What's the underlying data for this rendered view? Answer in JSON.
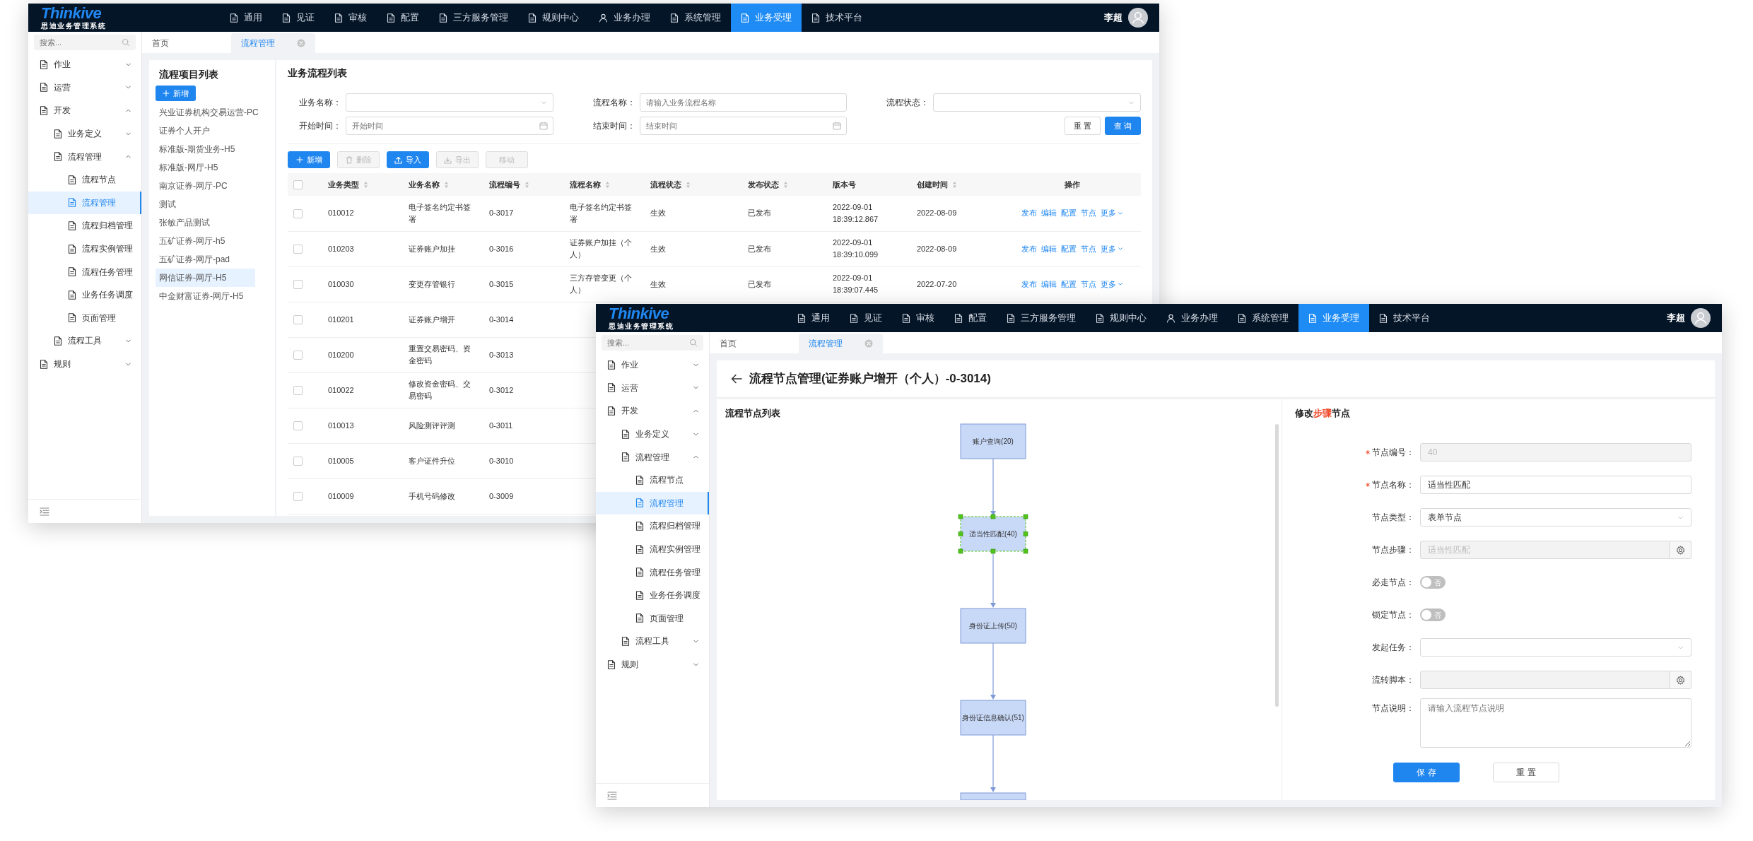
{
  "list_window": {
    "logo": {
      "name": "Thinkive",
      "subtitle": "思迪业务管理系统"
    },
    "nav": [
      {
        "label": "通用",
        "selected": false
      },
      {
        "label": "见证",
        "selected": false
      },
      {
        "label": "审核",
        "selected": false
      },
      {
        "label": "配置",
        "selected": false
      },
      {
        "label": "三方服务管理",
        "selected": false
      },
      {
        "label": "规则中心",
        "selected": false
      },
      {
        "label": "业务办理",
        "selected": false
      },
      {
        "label": "系统管理",
        "selected": false
      },
      {
        "label": "业务受理",
        "selected": true
      },
      {
        "label": "技术平台",
        "selected": false
      }
    ],
    "user": "李超",
    "sidebar": {
      "search_placeholder": "搜索...",
      "items": [
        {
          "label": "作业",
          "expanded": false
        },
        {
          "label": "运营",
          "expanded": false
        },
        {
          "label": "开发",
          "expanded": true,
          "children": [
            {
              "label": "业务定义",
              "expanded": false
            },
            {
              "label": "流程管理",
              "expanded": true,
              "children": [
                {
                  "label": "流程节点",
                  "selected": false
                },
                {
                  "label": "流程管理",
                  "selected": true
                },
                {
                  "label": "流程归档管理",
                  "selected": false
                },
                {
                  "label": "流程实例管理",
                  "selected": false
                },
                {
                  "label": "流程任务管理",
                  "selected": false
                },
                {
                  "label": "业务任务调度",
                  "selected": false
                },
                {
                  "label": "页面管理",
                  "selected": false
                }
              ]
            },
            {
              "label": "流程工具",
              "expanded": false
            }
          ]
        },
        {
          "label": "规则",
          "expanded": false
        }
      ]
    },
    "tabs": [
      {
        "label": "首页",
        "selected": false,
        "closable": false
      },
      {
        "label": "流程管理",
        "selected": true,
        "closable": true
      }
    ],
    "project_panel": {
      "title": "流程项目列表",
      "add_button": "新增",
      "projects": [
        {
          "label": "兴业证券机构交易运营-PC",
          "selected": false
        },
        {
          "label": "证券个人开户",
          "selected": false
        },
        {
          "label": "标准版-期货业务-H5",
          "selected": false
        },
        {
          "label": "标准版-网厅-H5",
          "selected": false
        },
        {
          "label": "南京证券-网厅-PC",
          "selected": false
        },
        {
          "label": "测试",
          "selected": false
        },
        {
          "label": "张敏产品测试",
          "selected": false
        },
        {
          "label": "五矿证券-网厅-h5",
          "selected": false
        },
        {
          "label": "五矿证券-网厅-pad",
          "selected": false
        },
        {
          "label": "网信证券-网厅-H5",
          "selected": true
        },
        {
          "label": "中金财富证券-网厅-H5",
          "selected": false
        }
      ]
    },
    "flow_list": {
      "title": "业务流程列表",
      "filters": [
        {
          "label": "业务名称：",
          "kind": "select"
        },
        {
          "label": "流程名称：",
          "kind": "text",
          "placeholder": "请输入业务流程名称"
        },
        {
          "label": "流程状态：",
          "kind": "select"
        },
        {
          "label": "开始时间：",
          "kind": "date",
          "placeholder": "开始时间"
        },
        {
          "label": "结束时间：",
          "kind": "date",
          "placeholder": "结束时间"
        }
      ],
      "filter_buttons": [
        {
          "label": "重 置",
          "kind": "default"
        },
        {
          "label": "查 询",
          "kind": "primary"
        }
      ],
      "toolbar": [
        {
          "label": "新增",
          "kind": "primary",
          "disabled": false
        },
        {
          "label": "删除",
          "kind": "default",
          "disabled": true
        },
        {
          "label": "导入",
          "kind": "primary",
          "disabled": false
        },
        {
          "label": "导出",
          "kind": "default",
          "disabled": true
        },
        {
          "label": "移动",
          "kind": "default",
          "disabled": true
        }
      ],
      "table": {
        "all_checked": false,
        "columns": [
          {
            "label": "业务类型",
            "sortable": true
          },
          {
            "label": "业务名称",
            "sortable": true
          },
          {
            "label": "流程编号",
            "sortable": true
          },
          {
            "label": "流程名称",
            "sortable": true
          },
          {
            "label": "流程状态",
            "sortable": true
          },
          {
            "label": "发布状态",
            "sortable": true
          },
          {
            "label": "版本号",
            "sortable": false
          },
          {
            "label": "创建时间",
            "sortable": true
          },
          {
            "label": "操作",
            "sortable": false
          }
        ],
        "rows": [
          {
            "checked": false,
            "cells": [
              "010012",
              "电子签名约定书签署",
              "0-3017",
              "电子签名约定书签署",
              "生效",
              "已发布",
              "2022-09-01 18:39:12.867",
              "2022-08-09"
            ],
            "actions": [
              {
                "label": "发布",
                "dropdown": false
              },
              {
                "label": "编辑",
                "dropdown": false
              },
              {
                "label": "配置",
                "dropdown": false
              },
              {
                "label": "节点",
                "dropdown": false
              },
              {
                "label": "更多",
                "dropdown": true
              }
            ]
          },
          {
            "checked": false,
            "cells": [
              "010203",
              "证券账户加挂",
              "0-3016",
              "证券账户加挂（个人）",
              "生效",
              "已发布",
              "2022-09-01 18:39:10.099",
              "2022-08-09"
            ],
            "actions": [
              {
                "label": "发布",
                "dropdown": false
              },
              {
                "label": "编辑",
                "dropdown": false
              },
              {
                "label": "配置",
                "dropdown": false
              },
              {
                "label": "节点",
                "dropdown": false
              },
              {
                "label": "更多",
                "dropdown": true
              }
            ]
          },
          {
            "checked": false,
            "cells": [
              "010030",
              "变更存管银行",
              "0-3015",
              "三方存管变更（个人）",
              "生效",
              "已发布",
              "2022-09-01 18:39:07.445",
              "2022-07-20"
            ],
            "actions": [
              {
                "label": "发布",
                "dropdown": false
              },
              {
                "label": "编辑",
                "dropdown": false
              },
              {
                "label": "配置",
                "dropdown": false
              },
              {
                "label": "节点",
                "dropdown": false
              },
              {
                "label": "更多",
                "dropdown": true
              }
            ]
          },
          {
            "checked": false,
            "cells": [
              "010201",
              "证券账户增开",
              "0-3014"
            ]
          },
          {
            "checked": false,
            "cells": [
              "010200",
              "重置交易密码、资金密码",
              "0-3013"
            ]
          },
          {
            "checked": false,
            "cells": [
              "010022",
              "修改资金密码、交易密码",
              "0-3012"
            ]
          },
          {
            "checked": false,
            "cells": [
              "010013",
              "风险测评评测",
              "0-3011"
            ]
          },
          {
            "checked": false,
            "cells": [
              "010005",
              "客户证件升位",
              "0-3010"
            ]
          },
          {
            "checked": false,
            "cells": [
              "010009",
              "手机号码修改",
              "0-3009"
            ]
          }
        ]
      }
    }
  },
  "node_window": {
    "logo": {
      "name": "Thinkive",
      "subtitle": "思迪业务管理系统"
    },
    "nav": [
      {
        "label": "通用",
        "selected": false
      },
      {
        "label": "见证",
        "selected": false
      },
      {
        "label": "审核",
        "selected": false
      },
      {
        "label": "配置",
        "selected": false
      },
      {
        "label": "三方服务管理",
        "selected": false
      },
      {
        "label": "规则中心",
        "selected": false
      },
      {
        "label": "业务办理",
        "selected": false
      },
      {
        "label": "系统管理",
        "selected": false
      },
      {
        "label": "业务受理",
        "selected": true
      },
      {
        "label": "技术平台",
        "selected": false
      }
    ],
    "user": "李超",
    "sidebar": {
      "search_placeholder": "搜索...",
      "items": [
        {
          "label": "作业",
          "expanded": false
        },
        {
          "label": "运营",
          "expanded": false
        },
        {
          "label": "开发",
          "expanded": true,
          "children": [
            {
              "label": "业务定义",
              "expanded": false
            },
            {
              "label": "流程管理",
              "expanded": true,
              "children": [
                {
                  "label": "流程节点",
                  "selected": false
                },
                {
                  "label": "流程管理",
                  "selected": true
                },
                {
                  "label": "流程归档管理",
                  "selected": false
                },
                {
                  "label": "流程实例管理",
                  "selected": false
                },
                {
                  "label": "流程任务管理",
                  "selected": false
                },
                {
                  "label": "业务任务调度",
                  "selected": false
                },
                {
                  "label": "页面管理",
                  "selected": false
                }
              ]
            },
            {
              "label": "流程工具",
              "expanded": false
            }
          ]
        },
        {
          "label": "规则",
          "expanded": false
        }
      ]
    },
    "tabs": [
      {
        "label": "首页",
        "selected": false,
        "closable": false
      },
      {
        "label": "流程管理",
        "selected": true,
        "closable": true
      }
    ],
    "node_editor": {
      "title": "流程节点管理(证券账户增开（个人）-0-3014)",
      "diagram": {
        "title": "流程节点列表",
        "nodes": [
          {
            "label": "账户查询(20)",
            "selected": false
          },
          {
            "label": "适当性匹配(40)",
            "selected": true
          },
          {
            "label": "身份证上传(50)",
            "selected": false
          },
          {
            "label": "身份证信息确认(51)",
            "selected": false
          },
          {
            "selected": false
          }
        ]
      },
      "form": {
        "title": "修改**步骤**节点",
        "fields": [
          {
            "label": "节点编号：",
            "kind": "input",
            "required": true,
            "disabled": true,
            "value": "40"
          },
          {
            "label": "节点名称：",
            "kind": "input",
            "required": true,
            "disabled": false,
            "value": "适当性匹配"
          },
          {
            "label": "节点类型：",
            "kind": "select",
            "required": false,
            "disabled": false,
            "value": "表单节点"
          },
          {
            "label": "节点步骤：",
            "kind": "picker",
            "required": false,
            "disabled": true,
            "value": "适当性匹配"
          },
          {
            "label": "必走节点：",
            "kind": "switch",
            "required": false,
            "disabled": false,
            "on": false,
            "text": "否"
          },
          {
            "label": "锁定节点：",
            "kind": "switch",
            "required": false,
            "disabled": false,
            "on": false,
            "text": "否"
          },
          {
            "label": "发起任务：",
            "kind": "select",
            "required": false,
            "disabled": false
          },
          {
            "label": "流转脚本：",
            "kind": "picker",
            "required": false,
            "disabled": true
          },
          {
            "label": "节点说明：",
            "kind": "textarea",
            "required": false,
            "disabled": false,
            "placeholder": "请输入流程节点说明"
          }
        ],
        "buttons": [
          {
            "label": "保 存",
            "kind": "primary"
          },
          {
            "label": "重 置",
            "kind": "default"
          }
        ]
      }
    }
  }
}
